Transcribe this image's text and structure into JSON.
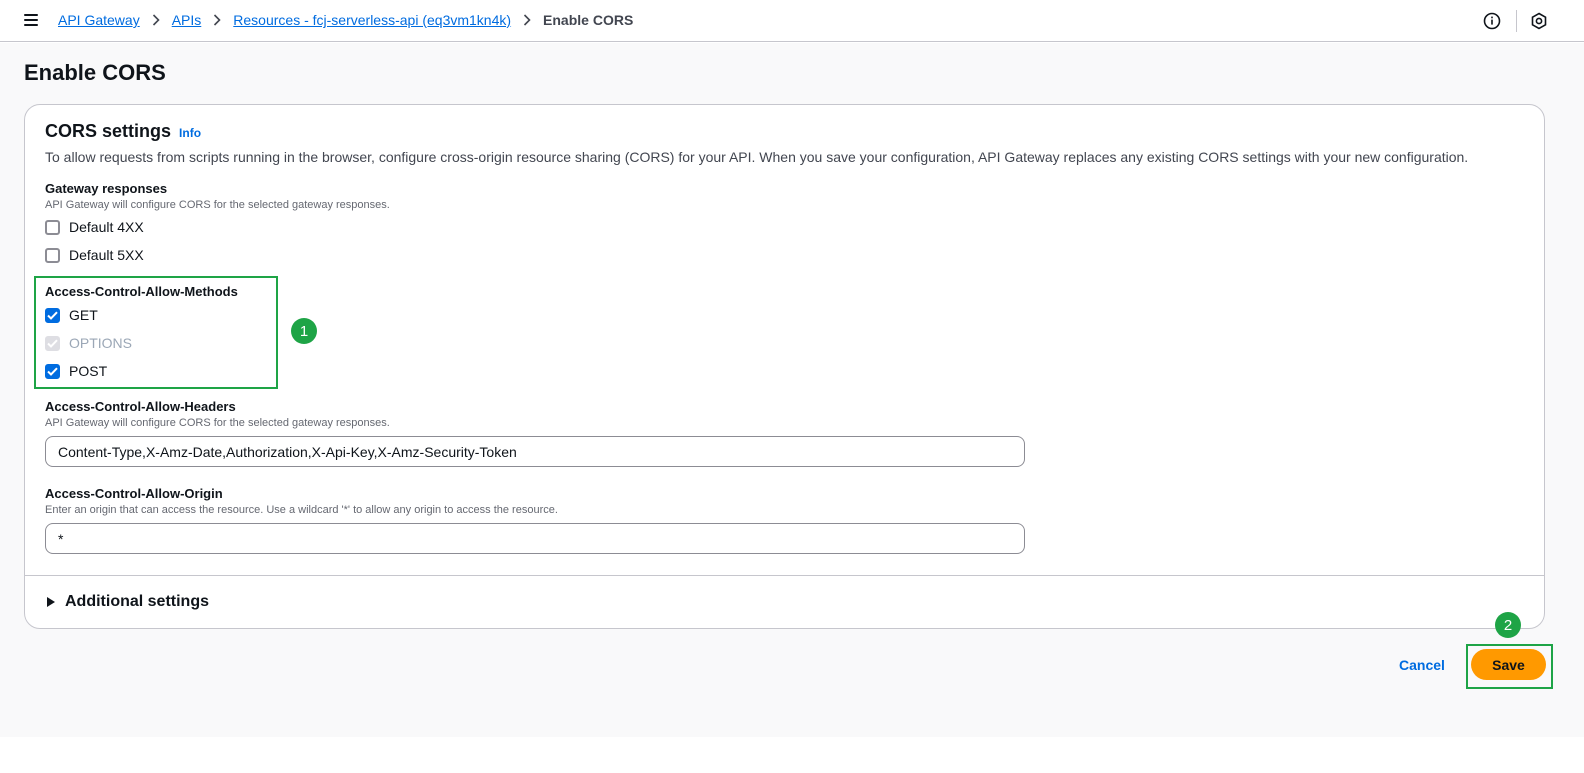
{
  "breadcrumbs": {
    "items": [
      "API Gateway",
      "APIs",
      "Resources - fcj-serverless-api (eq3vm1kn4k)"
    ],
    "current": "Enable CORS"
  },
  "page": {
    "title": "Enable CORS"
  },
  "cors": {
    "title": "CORS settings",
    "info_label": "Info",
    "description": "To allow requests from scripts running in the browser, configure cross-origin resource sharing (CORS) for your API. When you save your configuration, API Gateway replaces any existing CORS settings with your new configuration.",
    "gateway_responses": {
      "label": "Gateway responses",
      "description": "API Gateway will configure CORS for the selected gateway responses.",
      "options": [
        {
          "label": "Default 4XX",
          "checked": false
        },
        {
          "label": "Default 5XX",
          "checked": false
        }
      ]
    },
    "methods": {
      "label": "Access-Control-Allow-Methods",
      "options": [
        {
          "label": "GET",
          "checked": true,
          "disabled": false
        },
        {
          "label": "OPTIONS",
          "checked": true,
          "disabled": true
        },
        {
          "label": "POST",
          "checked": true,
          "disabled": false
        }
      ]
    },
    "headers": {
      "label": "Access-Control-Allow-Headers",
      "description": "API Gateway will configure CORS for the selected gateway responses.",
      "value": "Content-Type,X-Amz-Date,Authorization,X-Api-Key,X-Amz-Security-Token"
    },
    "origin": {
      "label": "Access-Control-Allow-Origin",
      "description": "Enter an origin that can access the resource. Use a wildcard '*' to allow any origin to access the resource.",
      "value": "*"
    },
    "additional_settings_label": "Additional settings"
  },
  "actions": {
    "cancel_label": "Cancel",
    "save_label": "Save"
  },
  "annotations": {
    "badge_1": "1",
    "badge_2": "2"
  },
  "colors": {
    "accent": "#006ce0",
    "primary_button": "#ff9900",
    "annotation": "#1ea446"
  },
  "icons": [
    "menu-icon",
    "chevron-right-icon",
    "info-circle-icon",
    "settings-hex-icon",
    "checkmark-icon",
    "caret-right-icon"
  ]
}
